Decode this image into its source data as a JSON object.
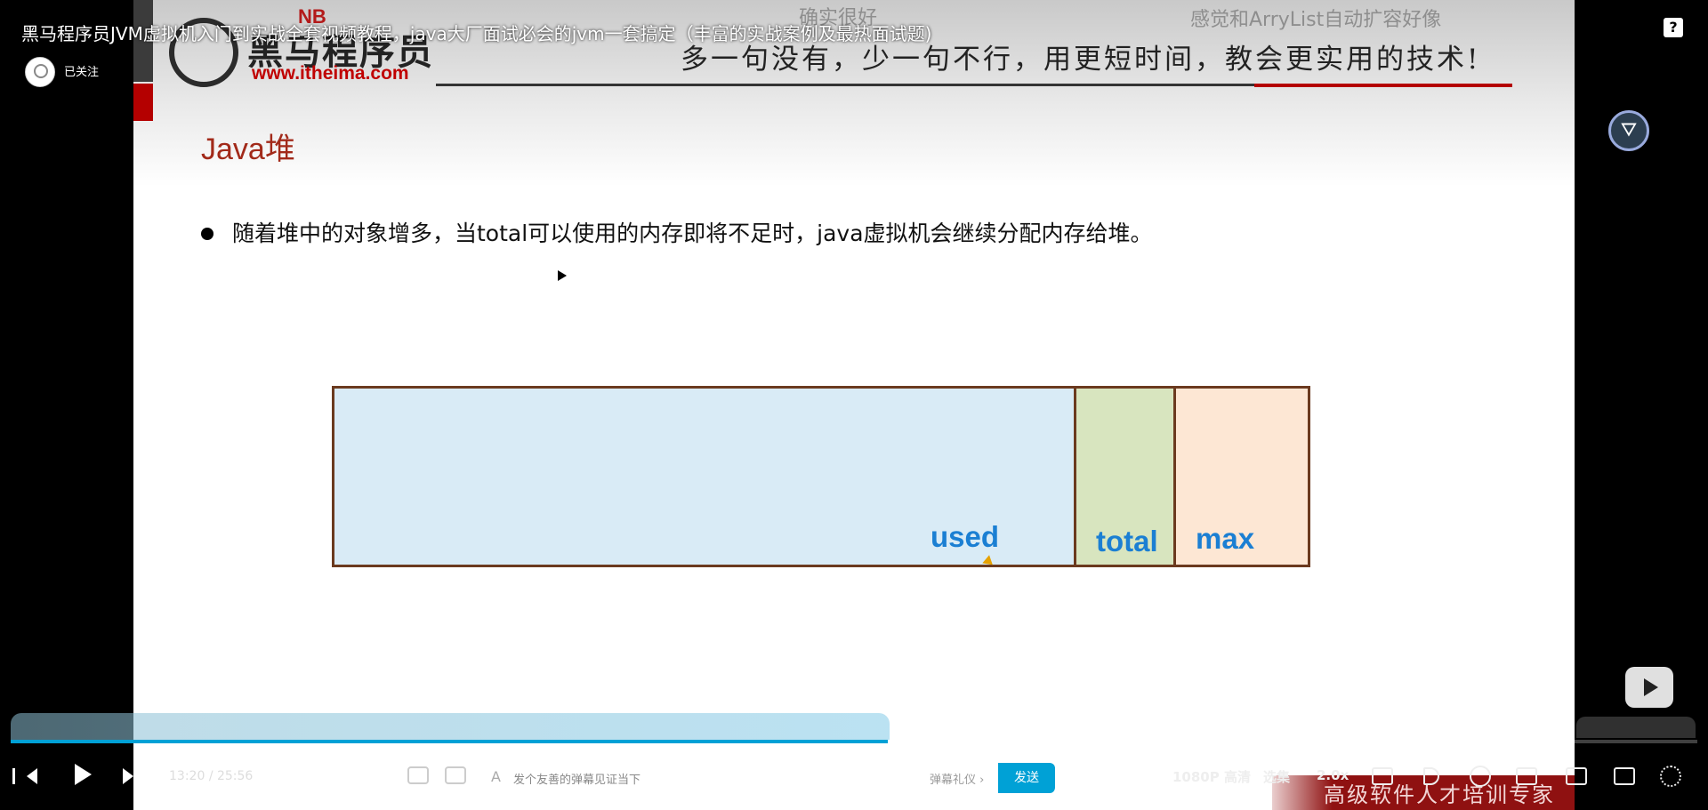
{
  "video": {
    "title": "黑马程序员JVM虚拟机入门到实战全套视频教程，java大厂面试必会的jvm一套搞定（丰富的实战案例及最热面试题)"
  },
  "uploader": {
    "follow_state": "已关注"
  },
  "danmaku": [
    "确实很好",
    "感觉和ArryList自动扩容好像"
  ],
  "slide": {
    "badge": "NB",
    "brand_name": "黑马程序员",
    "brand_url": "www.itheima.com",
    "slogan": "多一句没有，少一句不行，用更短时间，教会更实用的技术!",
    "heading": "Java堆",
    "bullet": "随着堆中的对象增多，当total可以使用的内存即将不足时，java虚拟机会继续分配内存给堆。",
    "memory_segments": [
      {
        "label": "used",
        "color": "#d9ebf6"
      },
      {
        "label": "total",
        "color": "#d8e5bf"
      },
      {
        "label": "max",
        "color": "#fde7d4"
      }
    ],
    "watermark": "高级软件人才培训专家"
  },
  "player": {
    "current_time": "13:20",
    "separator": "/",
    "duration": "25:56",
    "progress_fraction": 0.52,
    "danmaku_input_icon": "A",
    "danmaku_placeholder": "发个友善的弹幕见证当下",
    "danmaku_etiquette": "弹幕礼仪 ›",
    "send_label": "发送",
    "quality_label": "1080P 高清",
    "episodes_label": "选集",
    "speed_label": "2.0x",
    "help_label": "?",
    "accent_color": "#00a1d6"
  }
}
